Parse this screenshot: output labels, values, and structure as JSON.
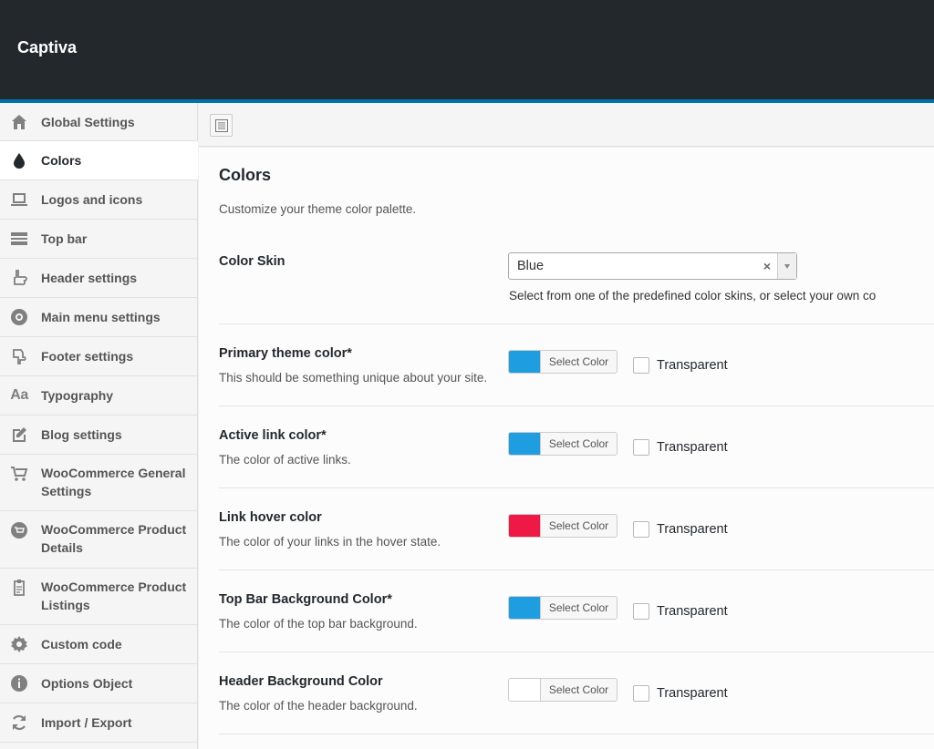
{
  "app": {
    "title": "Captiva"
  },
  "sidebar": {
    "items": [
      {
        "label": "Global Settings",
        "icon": "home-icon"
      },
      {
        "label": "Colors",
        "icon": "droplet-icon",
        "active": true
      },
      {
        "label": "Logos and icons",
        "icon": "laptop-icon"
      },
      {
        "label": "Top bar",
        "icon": "topbar-icon"
      },
      {
        "label": "Header settings",
        "icon": "hand-pointer-icon"
      },
      {
        "label": "Main menu settings",
        "icon": "gear-circle-icon"
      },
      {
        "label": "Footer settings",
        "icon": "hand-down-icon"
      },
      {
        "label": "Typography",
        "icon": "typography-icon"
      },
      {
        "label": "Blog settings",
        "icon": "edit-icon"
      },
      {
        "label": "WooCommerce General Settings",
        "icon": "cart-icon"
      },
      {
        "label": "WooCommerce Product Details",
        "icon": "product-icon"
      },
      {
        "label": "WooCommerce Product Listings",
        "icon": "clipboard-icon"
      },
      {
        "label": "Custom code",
        "icon": "gear-icon"
      },
      {
        "label": "Options Object",
        "icon": "info-icon"
      },
      {
        "label": "Import / Export",
        "icon": "refresh-icon"
      }
    ]
  },
  "main": {
    "title": "Colors",
    "description": "Customize your theme color palette.",
    "color_skin": {
      "label": "Color Skin",
      "value": "Blue",
      "clear_symbol": "×",
      "help": "Select from one of the predefined color skins, or select your own co"
    },
    "fields": [
      {
        "label": "Primary theme color*",
        "desc": "This should be something unique about your site.",
        "color": "#1e9ee0",
        "button": "Select Color",
        "transparent": "Transparent"
      },
      {
        "label": "Active link color*",
        "desc": "The color of active links.",
        "color": "#1e9ee0",
        "button": "Select Color",
        "transparent": "Transparent"
      },
      {
        "label": "Link hover color",
        "desc": "The color of your links in the hover state.",
        "color": "#ee1944",
        "button": "Select Color",
        "transparent": "Transparent"
      },
      {
        "label": "Top Bar Background Color*",
        "desc": "The color of the top bar background.",
        "color": "#1e9ee0",
        "button": "Select Color",
        "transparent": "Transparent"
      },
      {
        "label": "Header Background Color",
        "desc": "The color of the header background.",
        "color": "#ffffff",
        "button": "Select Color",
        "transparent": "Transparent"
      }
    ]
  }
}
